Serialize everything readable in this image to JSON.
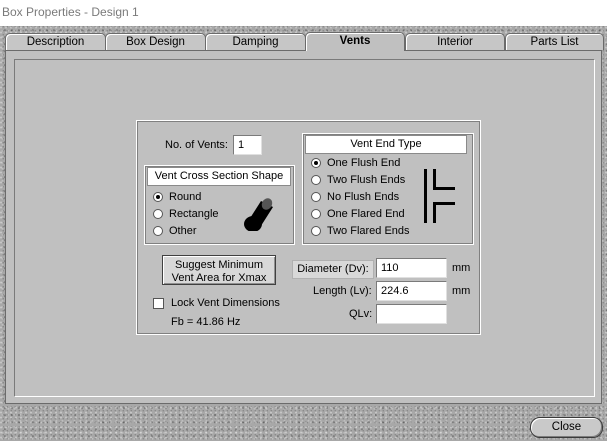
{
  "window": {
    "title": "Box Properties - Design 1"
  },
  "tabs": [
    {
      "label": "Description",
      "active": false
    },
    {
      "label": "Box Design",
      "active": false
    },
    {
      "label": "Damping",
      "active": false
    },
    {
      "label": "Vents",
      "active": true
    },
    {
      "label": "Interior",
      "active": false
    },
    {
      "label": "Parts List",
      "active": false
    }
  ],
  "vents": {
    "num_vents_label": "No. of Vents:",
    "num_vents_value": "1",
    "cross_section": {
      "title": "Vent Cross Section Shape",
      "options": [
        "Round",
        "Rectangle",
        "Other"
      ],
      "selected": "Round"
    },
    "end_type": {
      "title": "Vent End Type",
      "options": [
        "One Flush End",
        "Two Flush Ends",
        "No Flush Ends",
        "One Flared End",
        "Two Flared Ends"
      ],
      "selected": "One Flush End"
    },
    "suggest_button": {
      "line1": "Suggest Minimum",
      "line2": "Vent Area for Xmax"
    },
    "lock_label": "Lock Vent Dimensions",
    "lock_checked": false,
    "fb_text": "Fb = 41.86 Hz",
    "diameter": {
      "label": "Diameter (Dv):",
      "value": "110",
      "unit": "mm"
    },
    "length": {
      "label": "Length (Lv):",
      "value": "224.6",
      "unit": "mm"
    },
    "qlv": {
      "label": "QLv:",
      "value": ""
    }
  },
  "footer": {
    "close_label": "Close"
  },
  "colors": {
    "panel": "#c0c0c0",
    "granite": "#a8a8a8"
  }
}
